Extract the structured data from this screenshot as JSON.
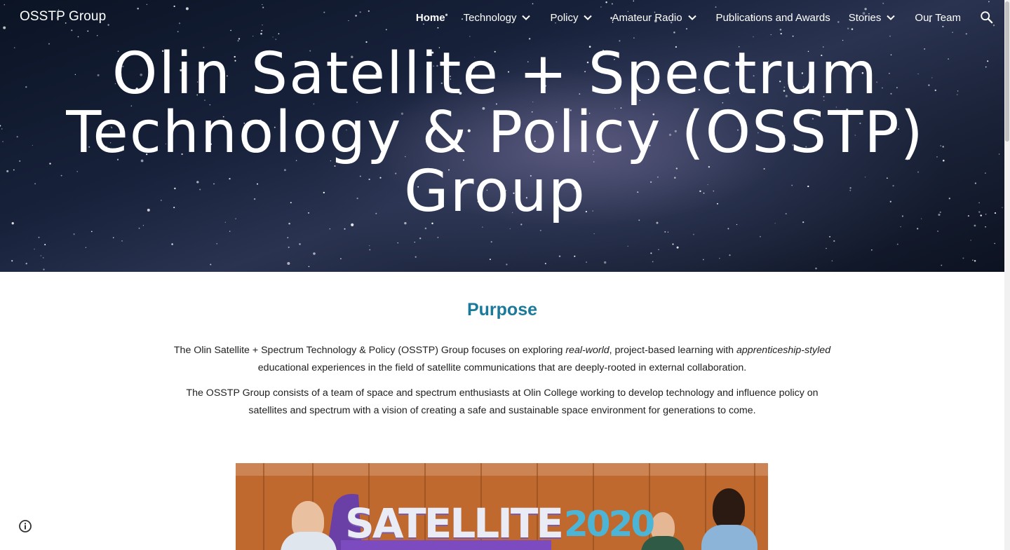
{
  "site": {
    "title": "OSSTP Group"
  },
  "nav": {
    "items": [
      {
        "label": "Home",
        "active": true,
        "has_dropdown": false
      },
      {
        "label": "Technology",
        "active": false,
        "has_dropdown": true
      },
      {
        "label": "Policy",
        "active": false,
        "has_dropdown": true
      },
      {
        "label": "Amateur Radio",
        "active": false,
        "has_dropdown": true
      },
      {
        "label": "Publications and Awards",
        "active": false,
        "has_dropdown": false
      },
      {
        "label": "Stories",
        "active": false,
        "has_dropdown": true
      },
      {
        "label": "Our Team",
        "active": false,
        "has_dropdown": false
      }
    ],
    "search_icon": "search-icon",
    "dropdown_icon": "chevron-down-icon"
  },
  "hero": {
    "title_line1": "Olin Satellite + Spectrum",
    "title_line2": "Technology & Policy (OSSTP)",
    "title_line3": "Group"
  },
  "purpose": {
    "heading": "Purpose",
    "p1_a": "The Olin Satellite + Spectrum Technology & Policy (OSSTP) Group focuses on exploring ",
    "p1_em1": "real-world",
    "p1_b": ", project-based learning with ",
    "p1_em2": "apprenticeship-styled",
    "p1_c": " educational experiences in the field of satellite communications that are deeply-rooted in external collaboration.",
    "p2": "The OSSTP Group consists of a team of space and spectrum enthusiasts at Olin College working to develop  technology and influence policy on satellites and spectrum with a vision of creating a safe and sustainable space environment for generations to come."
  },
  "photo": {
    "sign_text": "SATELLITE",
    "sign_year": "2020"
  },
  "footer": {
    "info_icon": "info-icon"
  },
  "colors": {
    "accent": "#1b7a9b",
    "text": "#212121",
    "hero_text": "#ffffff"
  }
}
